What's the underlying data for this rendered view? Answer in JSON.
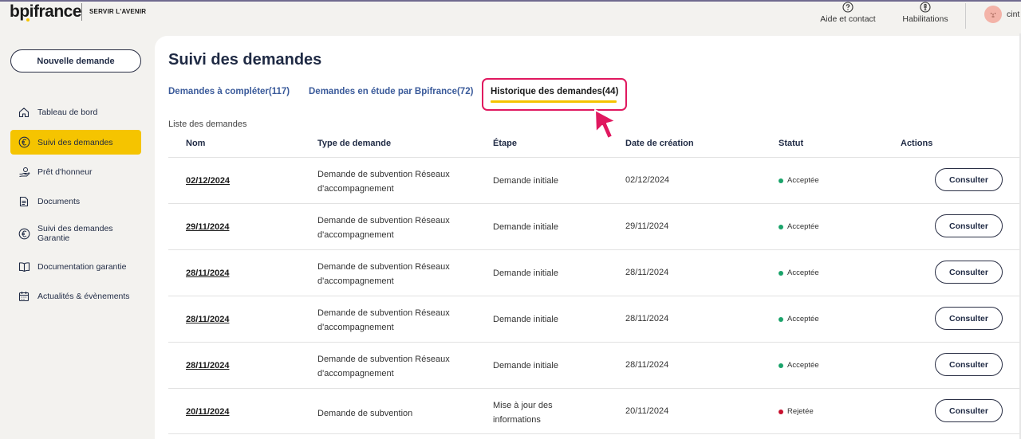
{
  "brand": {
    "logo_text": "bpifrance",
    "tagline": "SERVIR L'AVENIR",
    "accent_color": "#f5c400"
  },
  "header": {
    "help_label": "Aide et contact",
    "habilitations_label": "Habilitations",
    "user_name": "cint",
    "help_icon": "question-circle-icon",
    "habilitations_icon": "person-circle-icon"
  },
  "sidebar": {
    "new_request_label": "Nouvelle demande",
    "items": [
      {
        "label": "Tableau de bord",
        "icon": "home-icon"
      },
      {
        "label": "Suivi des demandes",
        "icon": "euro-icon",
        "active": true
      },
      {
        "label": "Prêt d'honneur",
        "icon": "hand-coin-icon"
      },
      {
        "label": "Documents",
        "icon": "document-icon"
      },
      {
        "label": "Suivi des demandes Garantie",
        "icon": "euro-icon"
      },
      {
        "label": "Documentation garantie",
        "icon": "book-icon"
      },
      {
        "label": "Actualités & évènements",
        "icon": "calendar-icon"
      }
    ]
  },
  "main": {
    "title": "Suivi des demandes",
    "tabs": [
      {
        "label": "Demandes à compléter(117)"
      },
      {
        "label": "Demandes en étude par Bpifrance(72)"
      },
      {
        "label": "Historique des demandes(44)",
        "active": true
      }
    ],
    "list_label": "Liste des demandes",
    "columns": [
      "Nom",
      "Type de demande",
      "Étape",
      "Date de création",
      "Statut",
      "Actions"
    ],
    "rows": [
      {
        "name": "02/12/2024",
        "type": "Demande de subvention Réseaux d'accompagnement",
        "etape": "Demande initiale",
        "date": "02/12/2024",
        "status": "Acceptée",
        "status_color": "#1aa36a",
        "action": "Consulter"
      },
      {
        "name": "29/11/2024",
        "type": "Demande de subvention Réseaux d'accompagnement",
        "etape": "Demande initiale",
        "date": "29/11/2024",
        "status": "Acceptée",
        "status_color": "#1aa36a",
        "action": "Consulter"
      },
      {
        "name": "28/11/2024",
        "type": "Demande de subvention Réseaux d'accompagnement",
        "etape": "Demande initiale",
        "date": "28/11/2024",
        "status": "Acceptée",
        "status_color": "#1aa36a",
        "action": "Consulter"
      },
      {
        "name": "28/11/2024",
        "type": "Demande de subvention Réseaux d'accompagnement",
        "etape": "Demande initiale",
        "date": "28/11/2024",
        "status": "Acceptée",
        "status_color": "#1aa36a",
        "action": "Consulter"
      },
      {
        "name": "28/11/2024",
        "type": "Demande de subvention Réseaux d'accompagnement",
        "etape": "Demande initiale",
        "date": "28/11/2024",
        "status": "Acceptée",
        "status_color": "#1aa36a",
        "action": "Consulter"
      },
      {
        "name": "20/11/2024",
        "type": "Demande de subvention",
        "etape": "Mise à jour des informations",
        "date": "20/11/2024",
        "status": "Rejetée",
        "status_color": "#c8102e",
        "action": "Consulter"
      }
    ]
  }
}
